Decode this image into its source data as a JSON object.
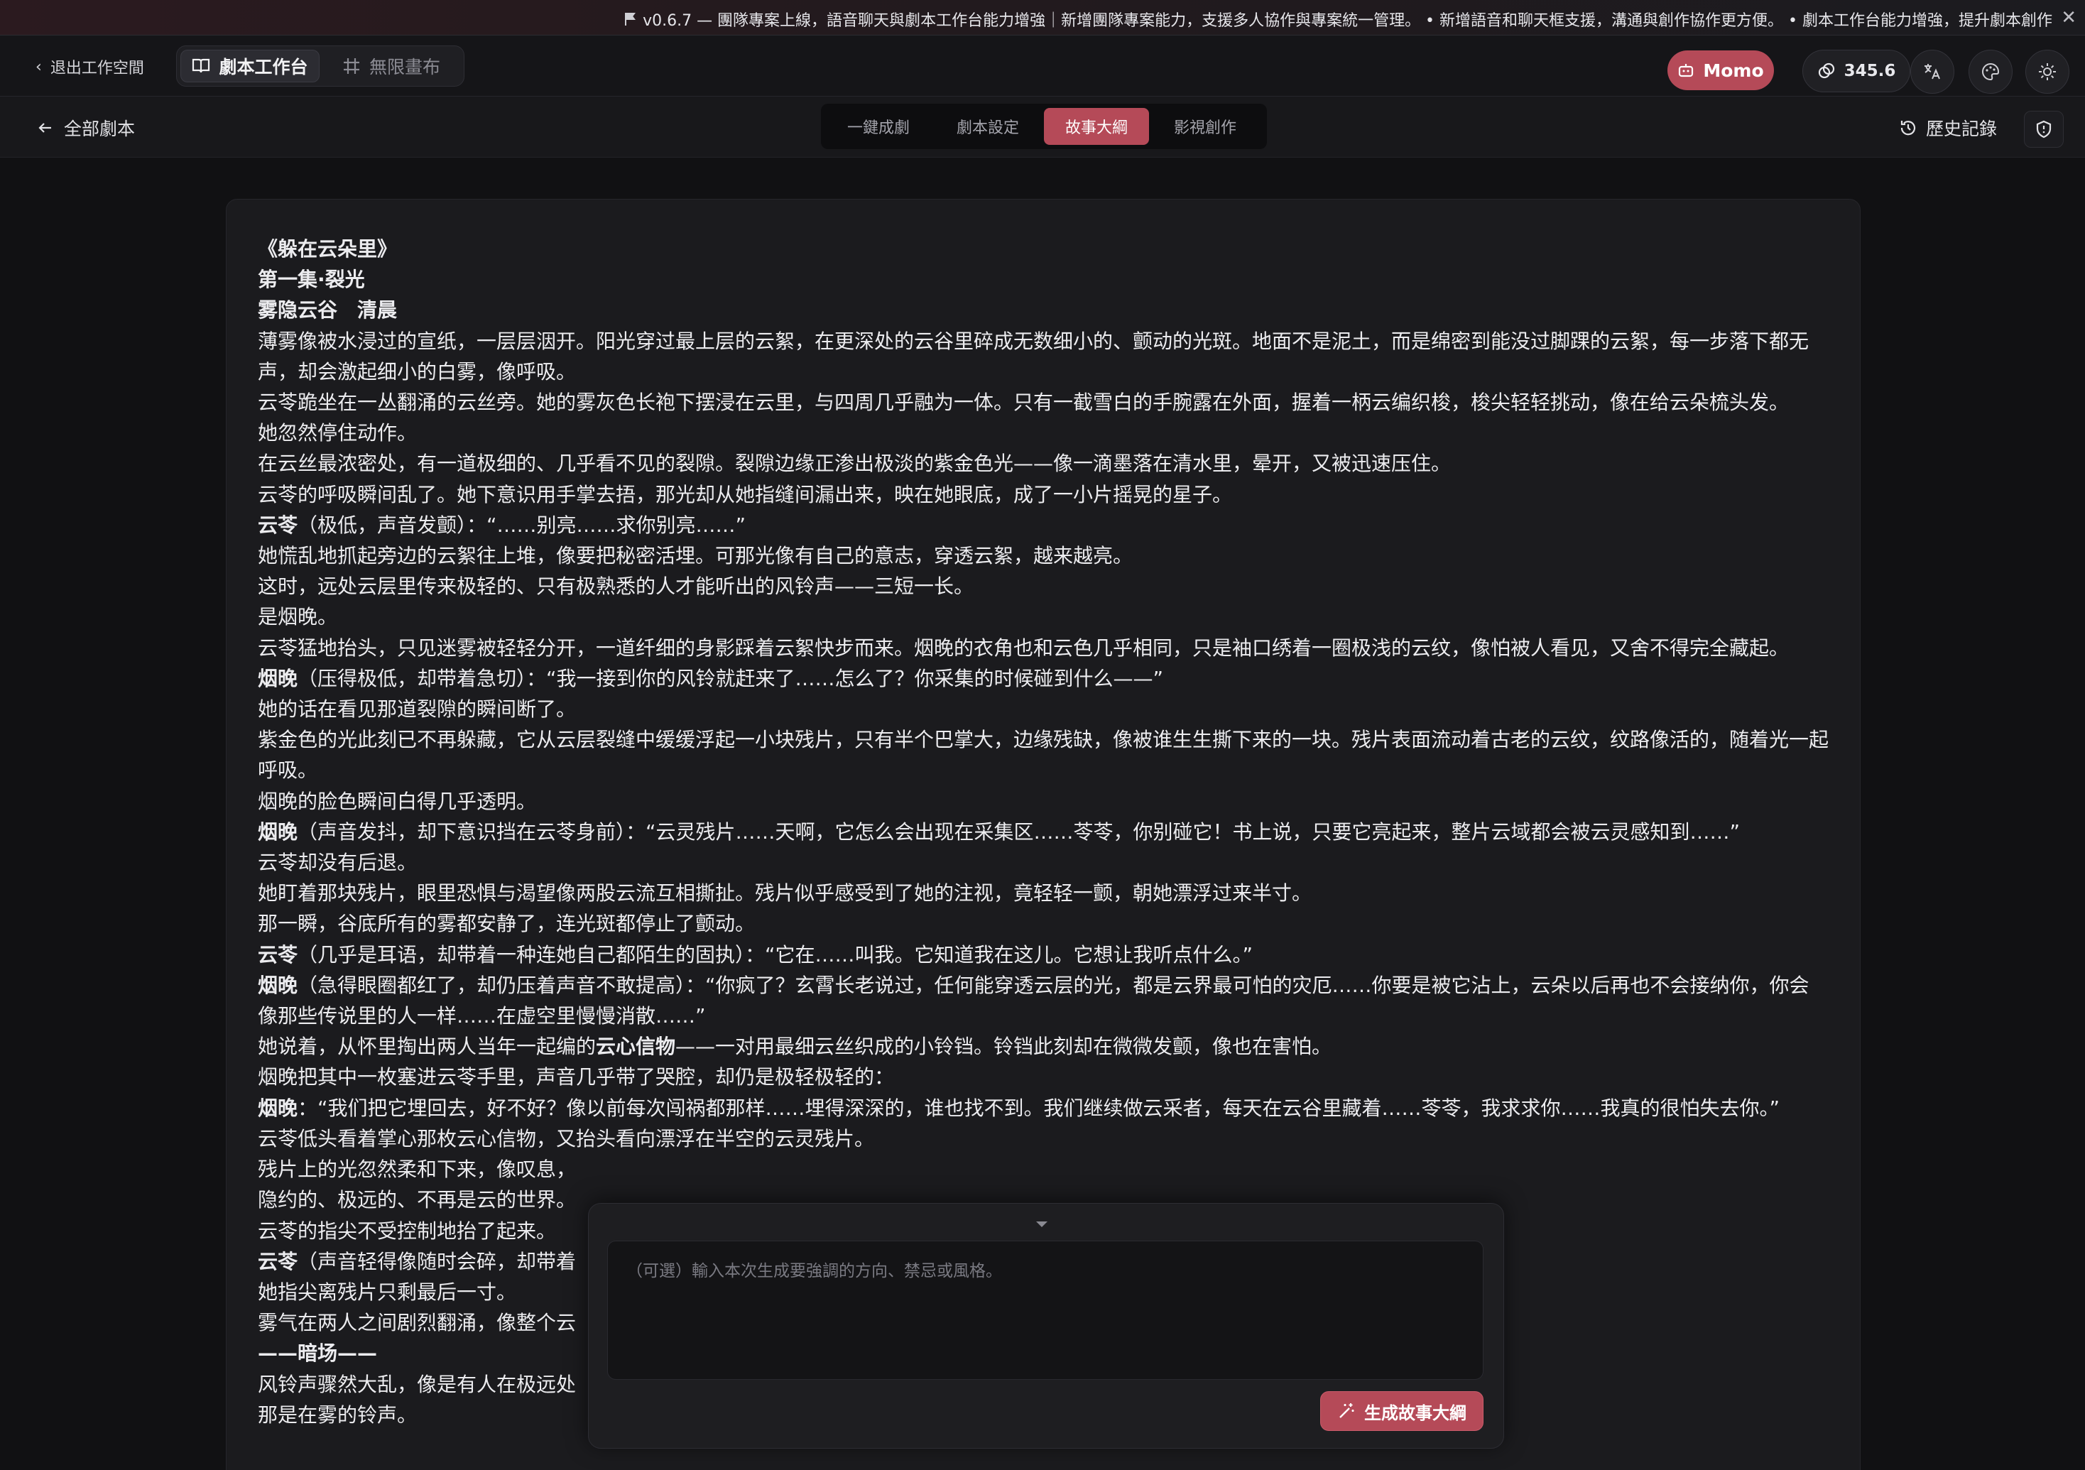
{
  "banner": {
    "text": "v0.6.7 — 團隊專案上線，語音聊天與劇本工作台能力增強｜新增團隊專案能力，支援多人協作與專案統一管理。 • 新增語音和聊天框支援，溝通與創作協作更方便。 • 劇本工作台能力增強，提升劇本創作",
    "close_icon": "close-icon"
  },
  "topbar": {
    "exit_label": "退出工作空間",
    "mode_tabs": [
      {
        "label": "劇本工作台",
        "icon": "book-icon",
        "active": true
      },
      {
        "label": "無限畫布",
        "icon": "grid-icon",
        "active": false
      }
    ],
    "momo_label": "Momo",
    "credits": "345.6"
  },
  "navbar": {
    "back_label": "全部劇本",
    "tabs": [
      {
        "label": "一鍵成劇",
        "active": false
      },
      {
        "label": "劇本設定",
        "active": false
      },
      {
        "label": "故事大綱",
        "active": true
      },
      {
        "label": "影視創作",
        "active": false
      }
    ],
    "history_label": "歷史記錄"
  },
  "script": {
    "lines": [
      {
        "text": "《躲在云朵里》",
        "bold": true
      },
      {
        "text": "第一集·裂光",
        "bold": true
      },
      {
        "text": "雾隐云谷　清晨",
        "bold": true
      },
      {
        "text": "薄雾像被水浸过的宣纸，一层层洇开。阳光穿过最上层的云絮，在更深处的云谷里碎成无数细小的、颤动的光斑。地面不是泥土，而是绵密到能没过脚踝的云絮，每一步落下都无声，却会激起细小的白雾，像呼吸。"
      },
      {
        "text": "云苓跪坐在一丛翻涌的云丝旁。她的雾灰色长袍下摆浸在云里，与四周几乎融为一体。只有一截雪白的手腕露在外面，握着一柄云编织梭，梭尖轻轻挑动，像在给云朵梳头发。"
      },
      {
        "text": "她忽然停住动作。"
      },
      {
        "text": "在云丝最浓密处，有一道极细的、几乎看不见的裂隙。裂隙边缘正渗出极淡的紫金色光——像一滴墨落在清水里，晕开，又被迅速压住。"
      },
      {
        "text": "云苓的呼吸瞬间乱了。她下意识用手掌去捂，那光却从她指缝间漏出来，映在她眼底，成了一小片摇晃的星子。"
      },
      {
        "speaker": "云苓",
        "text": "（极低，声音发颤）：“……别亮……求你别亮……”"
      },
      {
        "text": "她慌乱地抓起旁边的云絮往上堆，像要把秘密活埋。可那光像有自己的意志，穿透云絮，越来越亮。"
      },
      {
        "text": "这时，远处云层里传来极轻的、只有极熟悉的人才能听出的风铃声——三短一长。"
      },
      {
        "text": "是烟晚。"
      },
      {
        "text": "云苓猛地抬头，只见迷雾被轻轻分开，一道纤细的身影踩着云絮快步而来。烟晚的衣角也和云色几乎相同，只是袖口绣着一圈极浅的云纹，像怕被人看见，又舍不得完全藏起。"
      },
      {
        "speaker": "烟晚",
        "text": "（压得极低，却带着急切）：“我一接到你的风铃就赶来了……怎么了？你采集的时候碰到什么——”"
      },
      {
        "text": "她的话在看见那道裂隙的瞬间断了。"
      },
      {
        "text": "紫金色的光此刻已不再躲藏，它从云层裂缝中缓缓浮起一小块残片，只有半个巴掌大，边缘残缺，像被谁生生撕下来的一块。残片表面流动着古老的云纹，纹路像活的，随着光一起呼吸。"
      },
      {
        "text": "烟晚的脸色瞬间白得几乎透明。"
      },
      {
        "speaker": "烟晚",
        "text": "（声音发抖，却下意识挡在云苓身前）：“云灵残片……天啊，它怎么会出现在采集区……苓苓，你别碰它！书上说，只要它亮起来，整片云域都会被云灵感知到……”"
      },
      {
        "text": "云苓却没有后退。"
      },
      {
        "text": "她盯着那块残片，眼里恐惧与渴望像两股云流互相撕扯。残片似乎感受到了她的注视，竟轻轻一颤，朝她漂浮过来半寸。"
      },
      {
        "text": "那一瞬，谷底所有的雾都安静了，连光斑都停止了颤动。"
      },
      {
        "speaker": "云苓",
        "text": "（几乎是耳语，却带着一种连她自己都陌生的固执）：“它在……叫我。它知道我在这儿。它想让我听点什么。”"
      },
      {
        "speaker": "烟晚",
        "text": "（急得眼圈都红了，却仍压着声音不敢提高）：“你疯了？玄霄长老说过，任何能穿透云层的光，都是云界最可怕的灾厄……你要是被它沾上，云朵以后再也不会接纳你，你会像那些传说里的人一样……在虚空里慢慢消散……”"
      },
      {
        "text": "她说着，从怀里掏出两人当年一起编的",
        "strong": "云心信物",
        "tail": "——一对用最细云丝织成的小铃铛。铃铛此刻却在微微发颤，像也在害怕。"
      },
      {
        "text": "烟晚把其中一枚塞进云苓手里，声音几乎带了哭腔，却仍是极轻极轻的："
      },
      {
        "speaker": "烟晚",
        "text": "：“我们把它埋回去，好不好？像以前每次闯祸都那样……埋得深深的，谁也找不到。我们继续做云采者，每天在云谷里藏着……苓苓，我求求你……我真的很怕失去你。”"
      },
      {
        "text": "云苓低头看着掌心那枚云心信物，又抬头看向漂浮在半空的云灵残片。"
      },
      {
        "text": "残片上的光忽然柔和下来，像叹息，"
      },
      {
        "text": "隐约的、极远的、不再是云的世界。"
      },
      {
        "text": "云苓的指尖不受控制地抬了起来。"
      },
      {
        "speaker": "云苓",
        "text": "（声音轻得像随时会碎，却带着"
      },
      {
        "text": "她指尖离残片只剩最后一寸。"
      },
      {
        "text": "雾气在两人之间剧烈翻涌，像整个云"
      },
      {
        "text": "——暗场——",
        "bold": true
      },
      {
        "text": "风铃声骤然大乱，像是有人在极远处"
      },
      {
        "text": "那是在雾的铃声。"
      }
    ]
  },
  "prompt": {
    "placeholder": "（可選）輸入本次生成要強調的方向、禁忌或風格。",
    "value": "",
    "generate_label": "生成故事大綱"
  },
  "colors": {
    "accent": "#b54a58",
    "background": "#111113",
    "panel": "#1b1b1e"
  }
}
